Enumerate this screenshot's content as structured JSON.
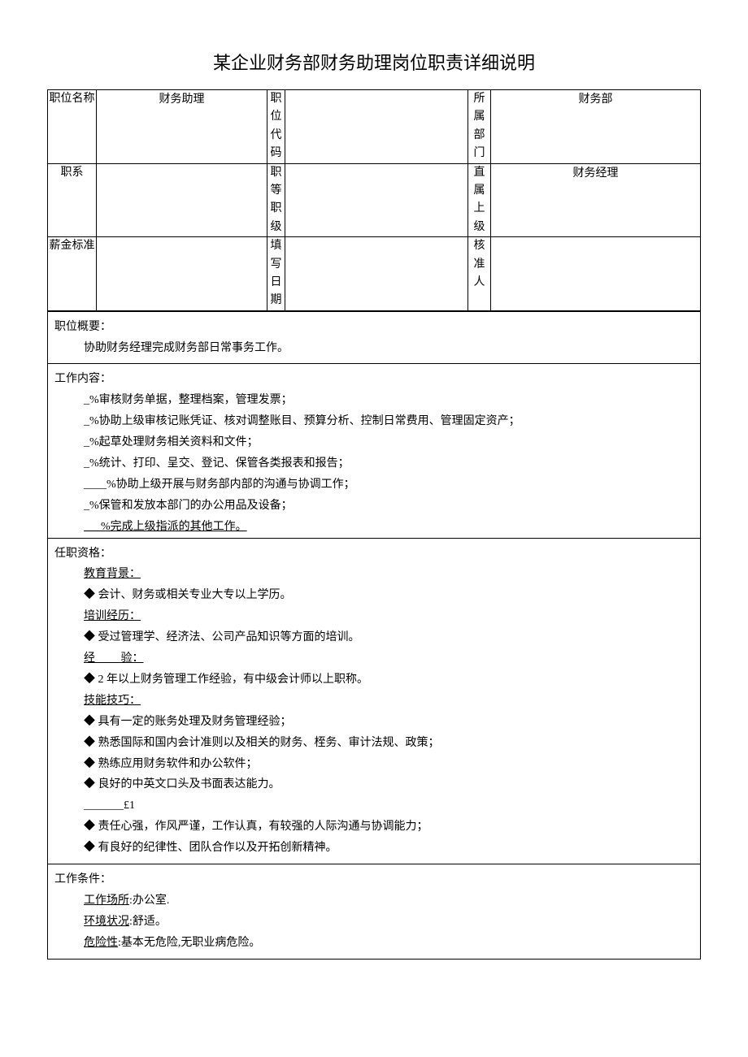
{
  "title": "某企业财务部财务助理岗位职责详细说明",
  "header": {
    "row1": {
      "label1": "职位名称",
      "value1": "财务助理",
      "label2": "职位代码",
      "value2": "",
      "label3": "所属部门",
      "value3": "财务部"
    },
    "row2": {
      "label1": "职系",
      "value1": "",
      "label2": "职等职级",
      "value2": "",
      "label3": "直属上级",
      "value3": "财务经理"
    },
    "row3": {
      "label1": "薪金标准",
      "value1": "",
      "label2": "填写日期",
      "value2": "",
      "label3": "核准人",
      "value3": ""
    }
  },
  "summary": {
    "heading": "职位概要：",
    "text": "协助财务经理完成财务部日常事务工作。"
  },
  "content": {
    "heading": "工作内容：",
    "lines": [
      "_%审核财务单据，整理档案，管理发票；",
      "_%协助上级审核记账凭证、核对调整账目、预算分析、控制日常费用、管理固定资产；",
      "_%起草处理财务相关资料和文件；",
      "_%统计、打印、呈交、登记、保管各类报表和报告；",
      "____%协助上级开展与财务部内部的沟通与协调工作；",
      "_%保管和发放本部门的办公用品及设备；",
      "___%完成上级指派的其他工作。"
    ]
  },
  "qualification": {
    "heading": "任职资格：",
    "edu_label": "教育背景：",
    "edu_text": "◆ 会计、财务或相关专业大专以上学历。",
    "train_label": "培训经历：",
    "train_text": "◆ 受过管理学、经济法、公司产品知识等方面的培训。",
    "exp_label_a": "经",
    "exp_label_b": "验：",
    "exp_text": "◆ 2 年以上财务管理工作经验，有中级会计师以上职称。",
    "skill_label_a": "技能",
    "skill_label_b": "技巧：",
    "skill_lines": [
      "◆ 具有一定的账务处理及财务管理经验；",
      "◆ 熟悉国际和国内会计准则以及相关的财务、桎务、审计法规、政策；",
      "◆ 熟练应用财务软件和办公软件；",
      "◆ 良好的中英文口头及书面表达能力。"
    ],
    "extra_marker": "_______£1",
    "attitude_lines": [
      "◆ 责任心强，作风严谨，工作认真，有较强的人际沟通与协调能力；",
      "◆ 有良好的纪律性、团队合作以及开拓创新精神。"
    ]
  },
  "conditions": {
    "heading": "工作条件：",
    "place_label": "工作场所",
    "place_text": ":办公室.",
    "env_label": "环境状况",
    "env_text": ":舒适。",
    "risk_label": "危险性",
    "risk_text": ":基本无危险,无职业病危险。"
  }
}
